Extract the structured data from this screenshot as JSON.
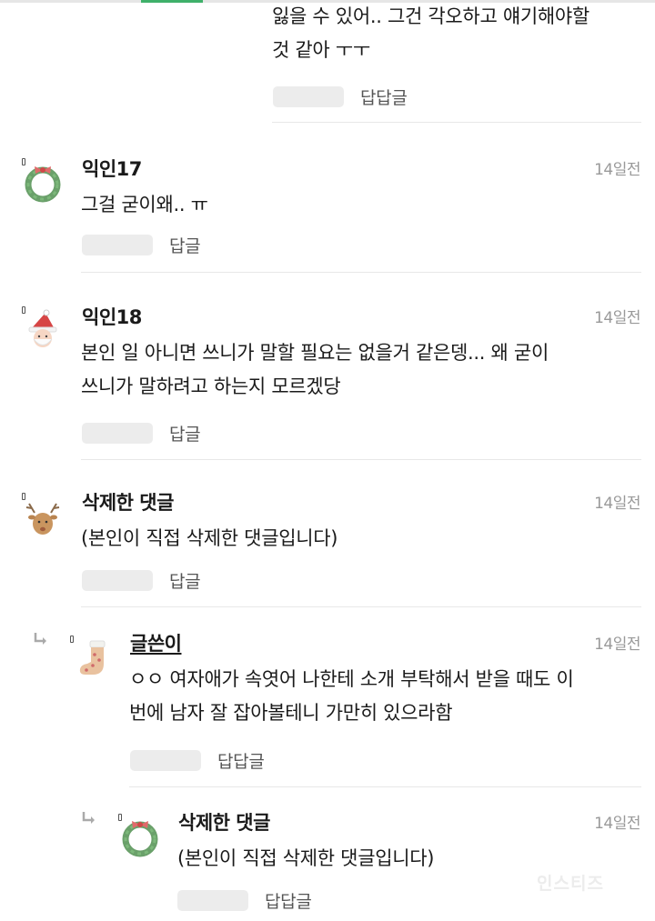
{
  "comments": [
    {
      "id": "c16",
      "nickname": "",
      "time": "",
      "lines": [
        "잃을 수 있어.. 그건 각오하고 얘기해야할",
        "것 같아 ㅜㅜ"
      ],
      "reply_label": "답답글",
      "avatar": "none"
    },
    {
      "id": "c17",
      "nickname": "익인17",
      "time": "14일전",
      "lines": [
        "그걸 굳이왜.. ㅠ"
      ],
      "reply_label": "답글",
      "avatar": "wreath-icon"
    },
    {
      "id": "c18",
      "nickname": "익인18",
      "time": "14일전",
      "lines": [
        "본인 일 아니면 쓰니가 말할 필요는 없을거 같은뎅... 왜 굳이",
        "쓰니가 말하려고 하는지 모르겠당"
      ],
      "reply_label": "답글",
      "avatar": "santa-icon"
    },
    {
      "id": "c19",
      "nickname": "삭제한 댓글",
      "time": "14일전",
      "lines": [
        "(본인이 직접 삭제한 댓글입니다)"
      ],
      "reply_label": "답글",
      "avatar": "reindeer-icon"
    },
    {
      "id": "c20",
      "nickname": "글쓴이",
      "time": "14일전",
      "lines": [
        "ㅇㅇ 여자애가 속엿어 나한테 소개 부탁해서 받을 때도 이",
        "번에 남자 잘 잡아볼테니 가만히 있으라함"
      ],
      "reply_label": "답답글",
      "avatar": "stocking-icon"
    },
    {
      "id": "c21",
      "nickname": "삭제한 댓글",
      "time": "14일전",
      "lines": [
        "(본인이 직접 삭제한 댓글입니다)"
      ],
      "reply_label": "답답글",
      "avatar": "wreath-icon"
    }
  ],
  "watermark": "인스티즈",
  "colors": {
    "accent": "#3fb06a",
    "time": "#999999",
    "divider": "#e8e8e8",
    "placeholder": "#ececec"
  }
}
